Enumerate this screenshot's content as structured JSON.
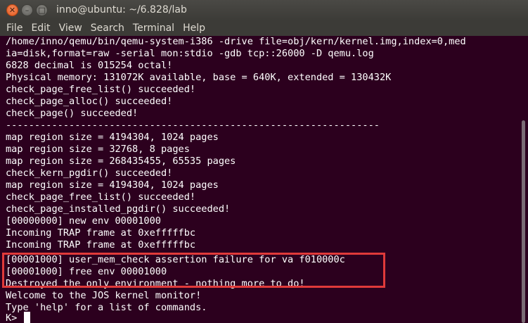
{
  "window": {
    "title": "inno@ubuntu: ~/6.828/lab",
    "buttons": {
      "close_glyph": "✕",
      "minimize_glyph": "–",
      "maximize_glyph": "□"
    }
  },
  "menu": {
    "items": [
      "File",
      "Edit",
      "View",
      "Search",
      "Terminal",
      "Help"
    ]
  },
  "terminal": {
    "lines": [
      "/home/inno/qemu/bin/qemu-system-i386 -drive file=obj/kern/kernel.img,index=0,med",
      "ia=disk,format=raw -serial mon:stdio -gdb tcp::26000 -D qemu.log",
      "6828 decimal is 015254 octal!",
      "Physical memory: 131072K available, base = 640K, extended = 130432K",
      "check_page_free_list() succeeded!",
      "check_page_alloc() succeeded!",
      "check_page() succeeded!",
      "-----------------------------------------------------------------",
      "map region size = 4194304, 1024 pages",
      "map region size = 32768, 8 pages",
      "map region size = 268435455, 65535 pages",
      "check_kern_pgdir() succeeded!",
      "map region size = 4194304, 1024 pages",
      "check_page_free_list() succeeded!",
      "check_page_installed_pgdir() succeeded!",
      "[00000000] new env 00001000",
      "Incoming TRAP frame at 0xefffffbc",
      "Incoming TRAP frame at 0xefffffbc",
      "[00001000] user_mem_check assertion failure for va f010000c",
      "[00001000] free env 00001000",
      "Destroyed the only environment - nothing more to do!",
      "Welcome to the JOS kernel monitor!",
      "Type 'help' for a list of commands.",
      "K> "
    ]
  },
  "colors": {
    "terminal_bg": "#2c001e",
    "terminal_fg": "#ffffff",
    "highlight_border": "#e03a3a",
    "titlebar_bg": "#3c3b37",
    "close_button": "#e25a1f"
  }
}
